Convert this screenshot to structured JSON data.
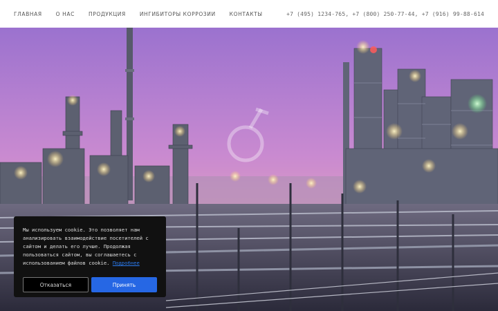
{
  "nav": {
    "items": [
      {
        "label": "ГЛАВНАЯ"
      },
      {
        "label": "О НАС"
      },
      {
        "label": "ПРОДУКЦИЯ"
      },
      {
        "label": "ИНГИБИТОРЫ КОРРОЗИИ"
      },
      {
        "label": "КОНТАКТЫ"
      }
    ]
  },
  "header": {
    "phones": "+7 (495) 1234-765, +7 (800) 250-77-44, +7 (916) 99-88-614"
  },
  "hero": {
    "logo_icon": "flask-icon",
    "sky_top": "#b57fd6",
    "sky_bottom": "#e09ab8"
  },
  "cookie": {
    "text": "Мы используем cookie. Это позволяет нам анализировать взаимодействие посетителей с сайтом и делать его лучше. Продолжая пользоваться сайтом, вы соглашаетесь с использованием файлов cookie.",
    "link_label": "Подробнее",
    "decline_label": "Отказаться",
    "accept_label": "Принять",
    "accent_color": "#2667e4"
  }
}
